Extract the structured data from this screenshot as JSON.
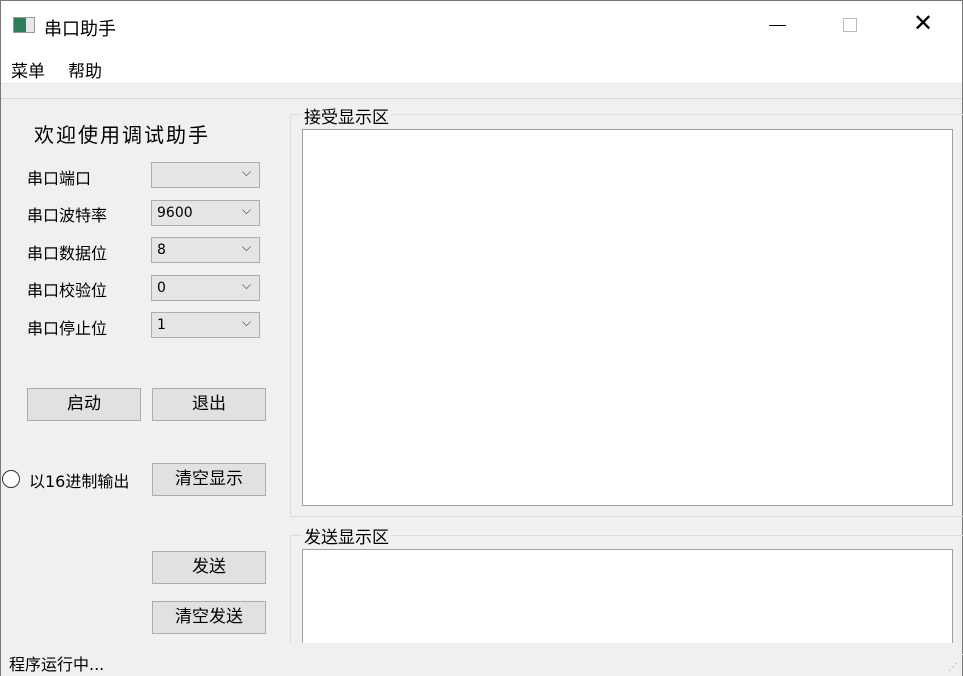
{
  "window": {
    "title": "串口助手",
    "icon": "app-window-icon",
    "controls": [
      "minimize-icon",
      "maximize-icon",
      "close-icon"
    ]
  },
  "menu": [
    "菜单",
    "帮助"
  ],
  "welcome": "欢迎使用调试助手",
  "settings": [
    {
      "label": "串口端口",
      "value": ""
    },
    {
      "label": "串口波特率",
      "value": "9600"
    },
    {
      "label": "串口数据位",
      "value": "8"
    },
    {
      "label": "串口校验位",
      "value": "0"
    },
    {
      "label": "串口停止位",
      "value": "1"
    }
  ],
  "buttons": {
    "start": "启动",
    "exit": "退出",
    "clear_display": "清空显示",
    "send": "发送",
    "clear_send": "清空发送"
  },
  "hex_radio": {
    "label": "以16进制输出",
    "checked": false
  },
  "receive_group": "接受显示区",
  "send_group": "发送显示区",
  "status": "程序运行中..."
}
